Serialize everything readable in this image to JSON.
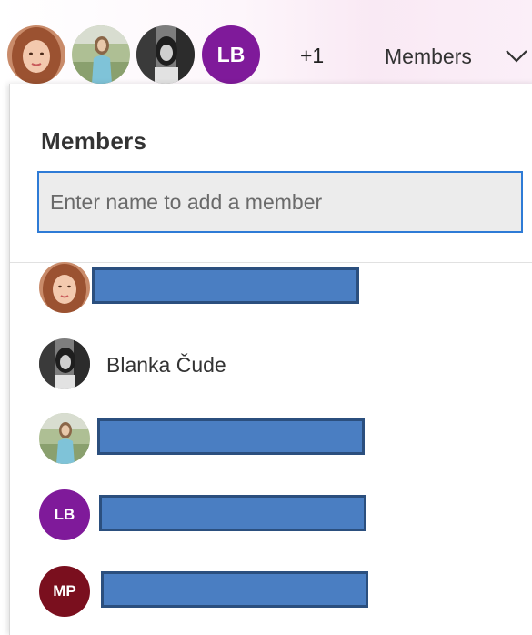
{
  "header": {
    "overflow_count": "+1",
    "members_label": "Members",
    "chevron_icon": "chevron-down-icon",
    "avatars": [
      {
        "kind": "photo",
        "desc": "member-photo-1"
      },
      {
        "kind": "photo",
        "desc": "member-photo-2"
      },
      {
        "kind": "photo",
        "desc": "member-photo-3"
      },
      {
        "kind": "initials",
        "initials": "LB",
        "color": "#7f1a9a"
      }
    ]
  },
  "panel": {
    "title": "Members",
    "add_member": {
      "placeholder": "Enter name to add a member",
      "value": ""
    },
    "members": [
      {
        "avatar": "photo",
        "name": "",
        "redacted": true
      },
      {
        "avatar": "photo",
        "name": "Blanka Čude",
        "redacted": false
      },
      {
        "avatar": "photo",
        "name": "",
        "redacted": true
      },
      {
        "avatar": "initials",
        "initials": "LB",
        "color": "#7f1a9a",
        "name": "",
        "redacted": true
      },
      {
        "avatar": "initials",
        "initials": "MP",
        "color": "#7a0f1e",
        "name": "",
        "redacted": true
      }
    ]
  },
  "colors": {
    "accent": "#2e7bd6",
    "redaction": "#4a7ec2",
    "lb_avatar": "#7f1a9a",
    "mp_avatar": "#7a0f1e"
  }
}
